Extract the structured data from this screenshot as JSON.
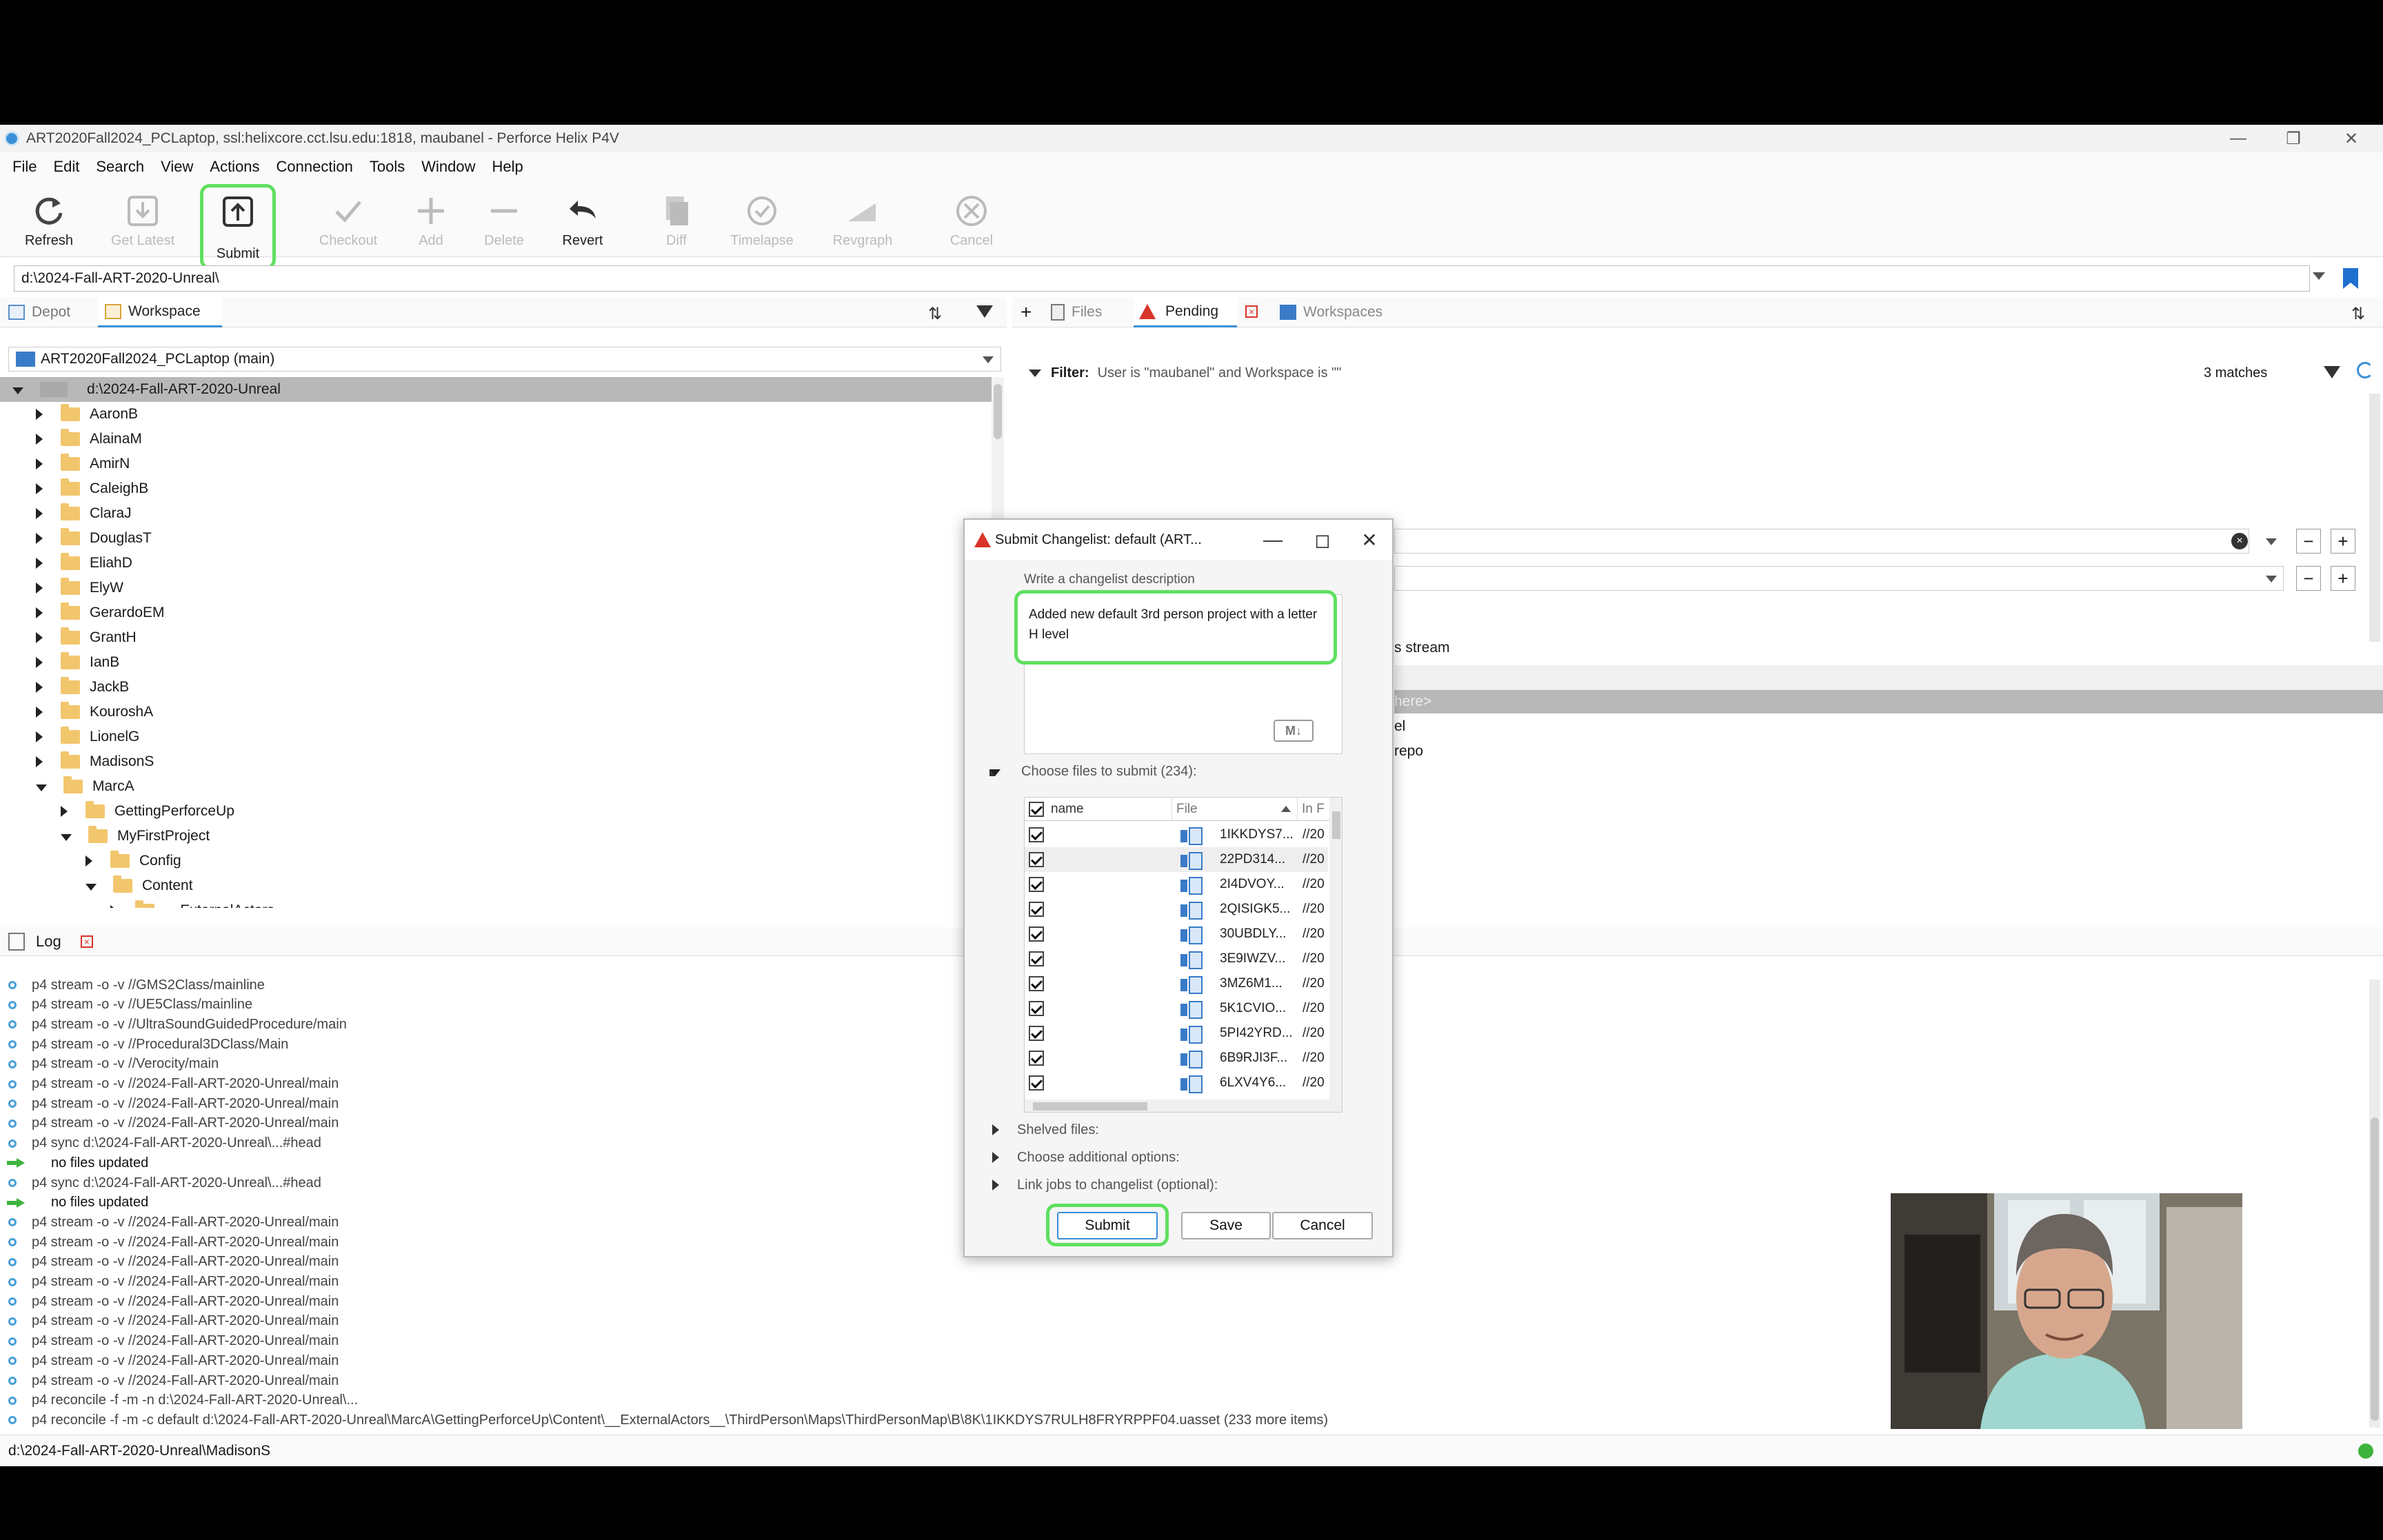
{
  "window": {
    "title": "ART2020Fall2024_PCLaptop,  ssl:helixcore.cct.lsu.edu:1818,  maubanel - Perforce Helix P4V"
  },
  "menu": [
    "File",
    "Edit",
    "Search",
    "View",
    "Actions",
    "Connection",
    "Tools",
    "Window",
    "Help"
  ],
  "toolbar": {
    "refresh": "Refresh",
    "get_latest": "Get Latest",
    "submit": "Submit",
    "checkout": "Checkout",
    "add": "Add",
    "delete": "Delete",
    "revert": "Revert",
    "diff": "Diff",
    "timelapse": "Timelapse",
    "revgraph": "Revgraph",
    "cancel": "Cancel"
  },
  "path_bar": "d:\\2024-Fall-ART-2020-Unreal\\",
  "left_tabs": {
    "depot": "Depot",
    "workspace": "Workspace"
  },
  "workspace_select": "ART2020Fall2024_PCLaptop (main)",
  "tree": {
    "root": "d:\\2024-Fall-ART-2020-Unreal",
    "items": [
      "AaronB",
      "AlainaM",
      "AmirN",
      "CaleighB",
      "ClaraJ",
      "DouglasT",
      "EliahD",
      "ElyW",
      "GerardoEM",
      "GrantH",
      "IanB",
      "JackB",
      "KouroshA",
      "LionelG",
      "MadisonS",
      "MarcA"
    ],
    "marca_children": [
      "GettingPerforceUp",
      "MyFirstProject"
    ],
    "project_children": [
      "Config",
      "Content"
    ],
    "content_children": [
      "__ExternalActors__"
    ]
  },
  "right_tabs": {
    "files": "Files",
    "pending": "Pending",
    "workspaces": "Workspaces"
  },
  "filter": {
    "label": "Filter:",
    "text": "User is \"maubanel\" and Workspace is \"\"",
    "matches": "3 matches"
  },
  "right_list": [
    "s stream",
    "here>",
    "el",
    "repo"
  ],
  "log_tab": "Log",
  "log": [
    {
      "type": "info",
      "text": "p4 stream -o -v //GMS2Class/mainline"
    },
    {
      "type": "info",
      "text": "p4 stream -o -v //UE5Class/mainline"
    },
    {
      "type": "info",
      "text": "p4 stream -o -v //UltraSoundGuidedProcedure/main"
    },
    {
      "type": "info",
      "text": "p4 stream -o -v //Procedural3DClass/Main"
    },
    {
      "type": "info",
      "text": "p4 stream -o -v //Verocity/main"
    },
    {
      "type": "info",
      "text": "p4 stream -o -v //2024-Fall-ART-2020-Unreal/main"
    },
    {
      "type": "info",
      "text": "p4 stream -o -v //2024-Fall-ART-2020-Unreal/main"
    },
    {
      "type": "info",
      "text": "p4 stream -o -v //2024-Fall-ART-2020-Unreal/main"
    },
    {
      "type": "info",
      "text": "p4 sync d:\\2024-Fall-ART-2020-Unreal\\...#head"
    },
    {
      "type": "result",
      "text": "no files updated"
    },
    {
      "type": "info",
      "text": "p4 sync d:\\2024-Fall-ART-2020-Unreal\\...#head"
    },
    {
      "type": "result",
      "text": "no files updated"
    },
    {
      "type": "info",
      "text": "p4 stream -o -v //2024-Fall-ART-2020-Unreal/main"
    },
    {
      "type": "info",
      "text": "p4 stream -o -v //2024-Fall-ART-2020-Unreal/main"
    },
    {
      "type": "info",
      "text": "p4 stream -o -v //2024-Fall-ART-2020-Unreal/main"
    },
    {
      "type": "info",
      "text": "p4 stream -o -v //2024-Fall-ART-2020-Unreal/main"
    },
    {
      "type": "info",
      "text": "p4 stream -o -v //2024-Fall-ART-2020-Unreal/main"
    },
    {
      "type": "info",
      "text": "p4 stream -o -v //2024-Fall-ART-2020-Unreal/main"
    },
    {
      "type": "info",
      "text": "p4 stream -o -v //2024-Fall-ART-2020-Unreal/main"
    },
    {
      "type": "info",
      "text": "p4 stream -o -v //2024-Fall-ART-2020-Unreal/main"
    },
    {
      "type": "info",
      "text": "p4 stream -o -v //2024-Fall-ART-2020-Unreal/main"
    },
    {
      "type": "info",
      "text": "p4 reconcile -f -m -n d:\\2024-Fall-ART-2020-Unreal\\..."
    },
    {
      "type": "info",
      "text": "p4 reconcile -f -m -c default d:\\2024-Fall-ART-2020-Unreal\\MarcA\\GettingPerforceUp\\Content\\__ExternalActors__\\ThirdPerson\\Maps\\ThirdPersonMap\\B\\8K\\1IKKDYS7RULH8FRYRPPF04.uasset (233 more items)"
    }
  ],
  "status_path": "d:\\2024-Fall-ART-2020-Unreal\\MadisonS",
  "dialog": {
    "title": "Submit Changelist: default (ART...",
    "desc_label": "Write a changelist description",
    "description": "Added new default 3rd person project with a letter H level",
    "markdown_label": "M↓",
    "files_label": "Choose files to submit (234):",
    "columns": {
      "name": "name",
      "file": "File",
      "in": "In F"
    },
    "files": [
      {
        "name": "1IKKDYS7...",
        "path": "//20"
      },
      {
        "name": "22PD314...",
        "path": "//20"
      },
      {
        "name": "2I4DVOY...",
        "path": "//20"
      },
      {
        "name": "2QISIGK5...",
        "path": "//20"
      },
      {
        "name": "30UBDLY...",
        "path": "//20"
      },
      {
        "name": "3E9IWZV...",
        "path": "//20"
      },
      {
        "name": "3MZ6M1...",
        "path": "//20"
      },
      {
        "name": "5K1CVIO...",
        "path": "//20"
      },
      {
        "name": "5PI42YRD...",
        "path": "//20"
      },
      {
        "name": "6B9RJI3F...",
        "path": "//20"
      },
      {
        "name": "6LXV4Y6...",
        "path": "//20"
      }
    ],
    "shelved": "Shelved files:",
    "additional": "Choose additional options:",
    "link_jobs": "Link jobs to changelist (optional):",
    "submit_label": "Submit",
    "save_label": "Save",
    "cancel_label": "Cancel"
  },
  "colors": {
    "highlight": "#5fe05f",
    "accent": "#3a8fd8",
    "warning": "#d9342b"
  }
}
